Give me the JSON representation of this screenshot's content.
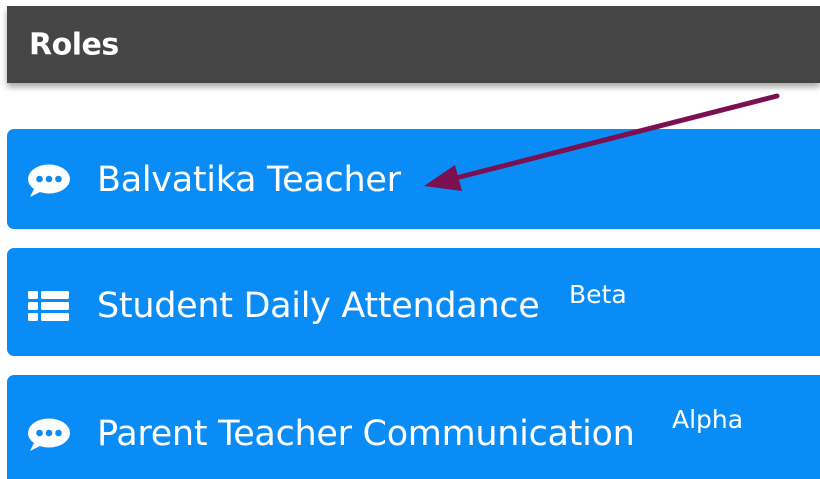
{
  "header": {
    "title": "Roles"
  },
  "roles": [
    {
      "label": "Balvatika Teacher",
      "tag": "",
      "icon": "comment-icon"
    },
    {
      "label": "Student Daily Attendance",
      "tag": "Beta",
      "icon": "list-icon"
    },
    {
      "label": "Parent Teacher Communication",
      "tag": "Alpha",
      "icon": "comment-icon"
    }
  ],
  "colors": {
    "header_bg": "#454545",
    "card_bg": "#0a8cf6",
    "text": "#ffffff",
    "annotation_arrow": "#7a1050"
  }
}
